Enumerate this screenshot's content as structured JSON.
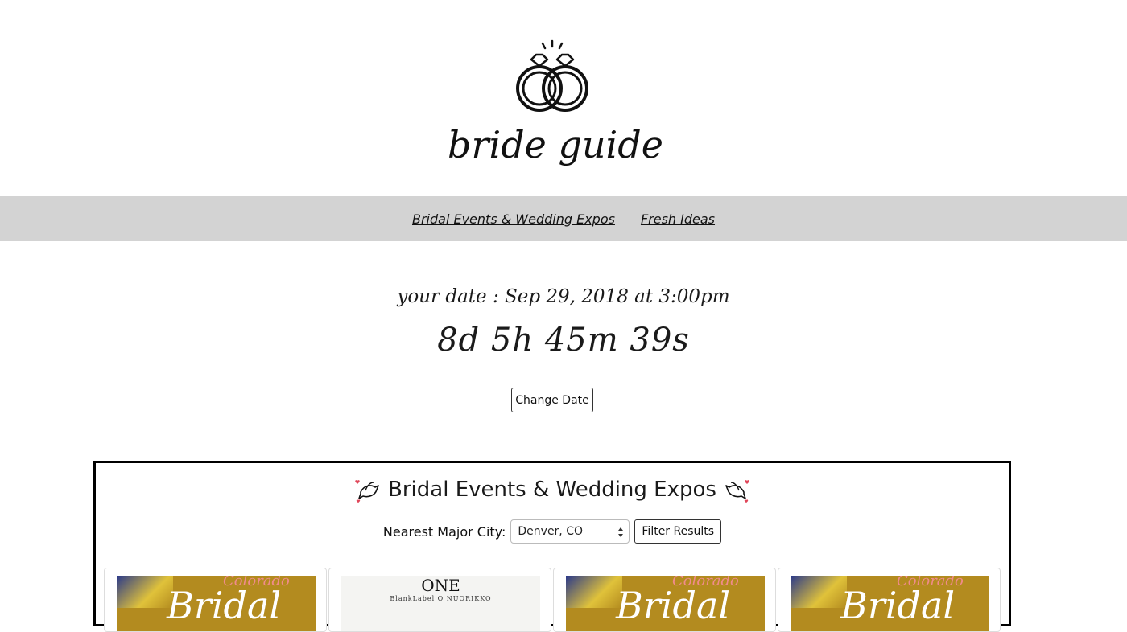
{
  "header": {
    "brand": "bride guide"
  },
  "nav": {
    "items": [
      {
        "label": "Bridal Events & Wedding Expos"
      },
      {
        "label": "Fresh Ideas"
      }
    ]
  },
  "countdown": {
    "date_text": "your date : Sep 29, 2018 at 3:00pm",
    "remaining": "8d 5h 45m 39s",
    "change_button": "Change Date"
  },
  "events": {
    "title": "Bridal Events & Wedding Expos",
    "filter_label": "Nearest Major City:",
    "selected_city": "Denver, CO",
    "filter_button": "Filter Results",
    "cards": [
      {
        "top_word": "Colorado",
        "big_word": "Bridal"
      },
      {
        "title": "ONE",
        "subtitle": "BlankLabel  O  NUORIKKO"
      },
      {
        "top_word": "Colorado",
        "big_word": "Bridal"
      },
      {
        "top_word": "Colorado",
        "big_word": "Bridal"
      }
    ]
  },
  "colors": {
    "nav_bg": "#d3d3d3",
    "card_gold": "#b38b1f",
    "heart": "#e0475a"
  },
  "icons": {
    "logo": "wedding-rings-icon",
    "dove": "dove-icon",
    "select_arrows": "select-arrows-icon"
  }
}
